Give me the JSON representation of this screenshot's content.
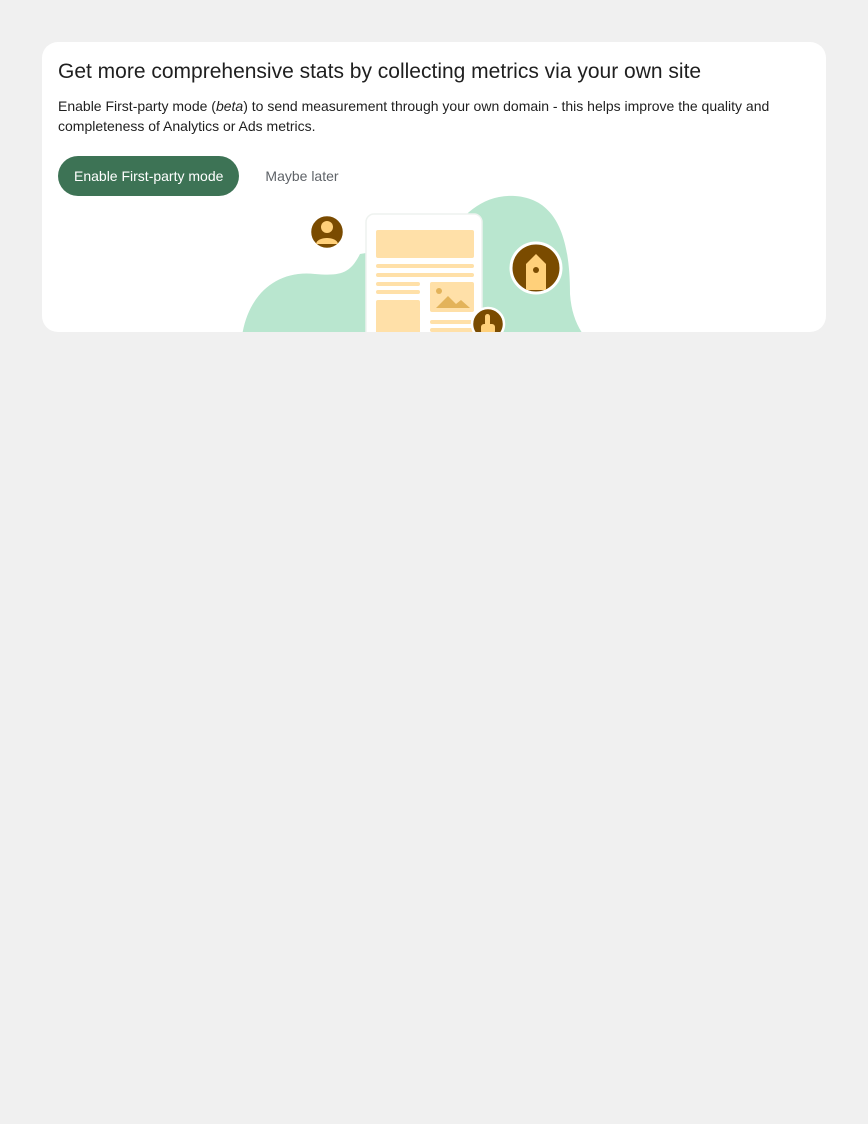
{
  "banner": {
    "title": "Get more comprehensive stats by collecting metrics via your own site",
    "description_before": "Enable First-party mode (",
    "description_emphasis": "beta",
    "description_after": ") to send measurement through your own domain - this helps improve the quality and completeness of Analytics or Ads metrics.",
    "primary_button_label": "Enable First-party mode",
    "secondary_button_label": "Maybe later"
  },
  "colors": {
    "page_background": "#f0f0f0",
    "card_background": "#ffffff",
    "primary_button": "#3d7355",
    "illustration_blob": "#b9e6cf",
    "illustration_accent": "#ffe0a8",
    "icon_badge": "#7a4b00"
  },
  "icons": {
    "person": "person-icon",
    "tag": "tag-icon",
    "pointer": "hand-pointer-icon",
    "image": "image-icon"
  }
}
